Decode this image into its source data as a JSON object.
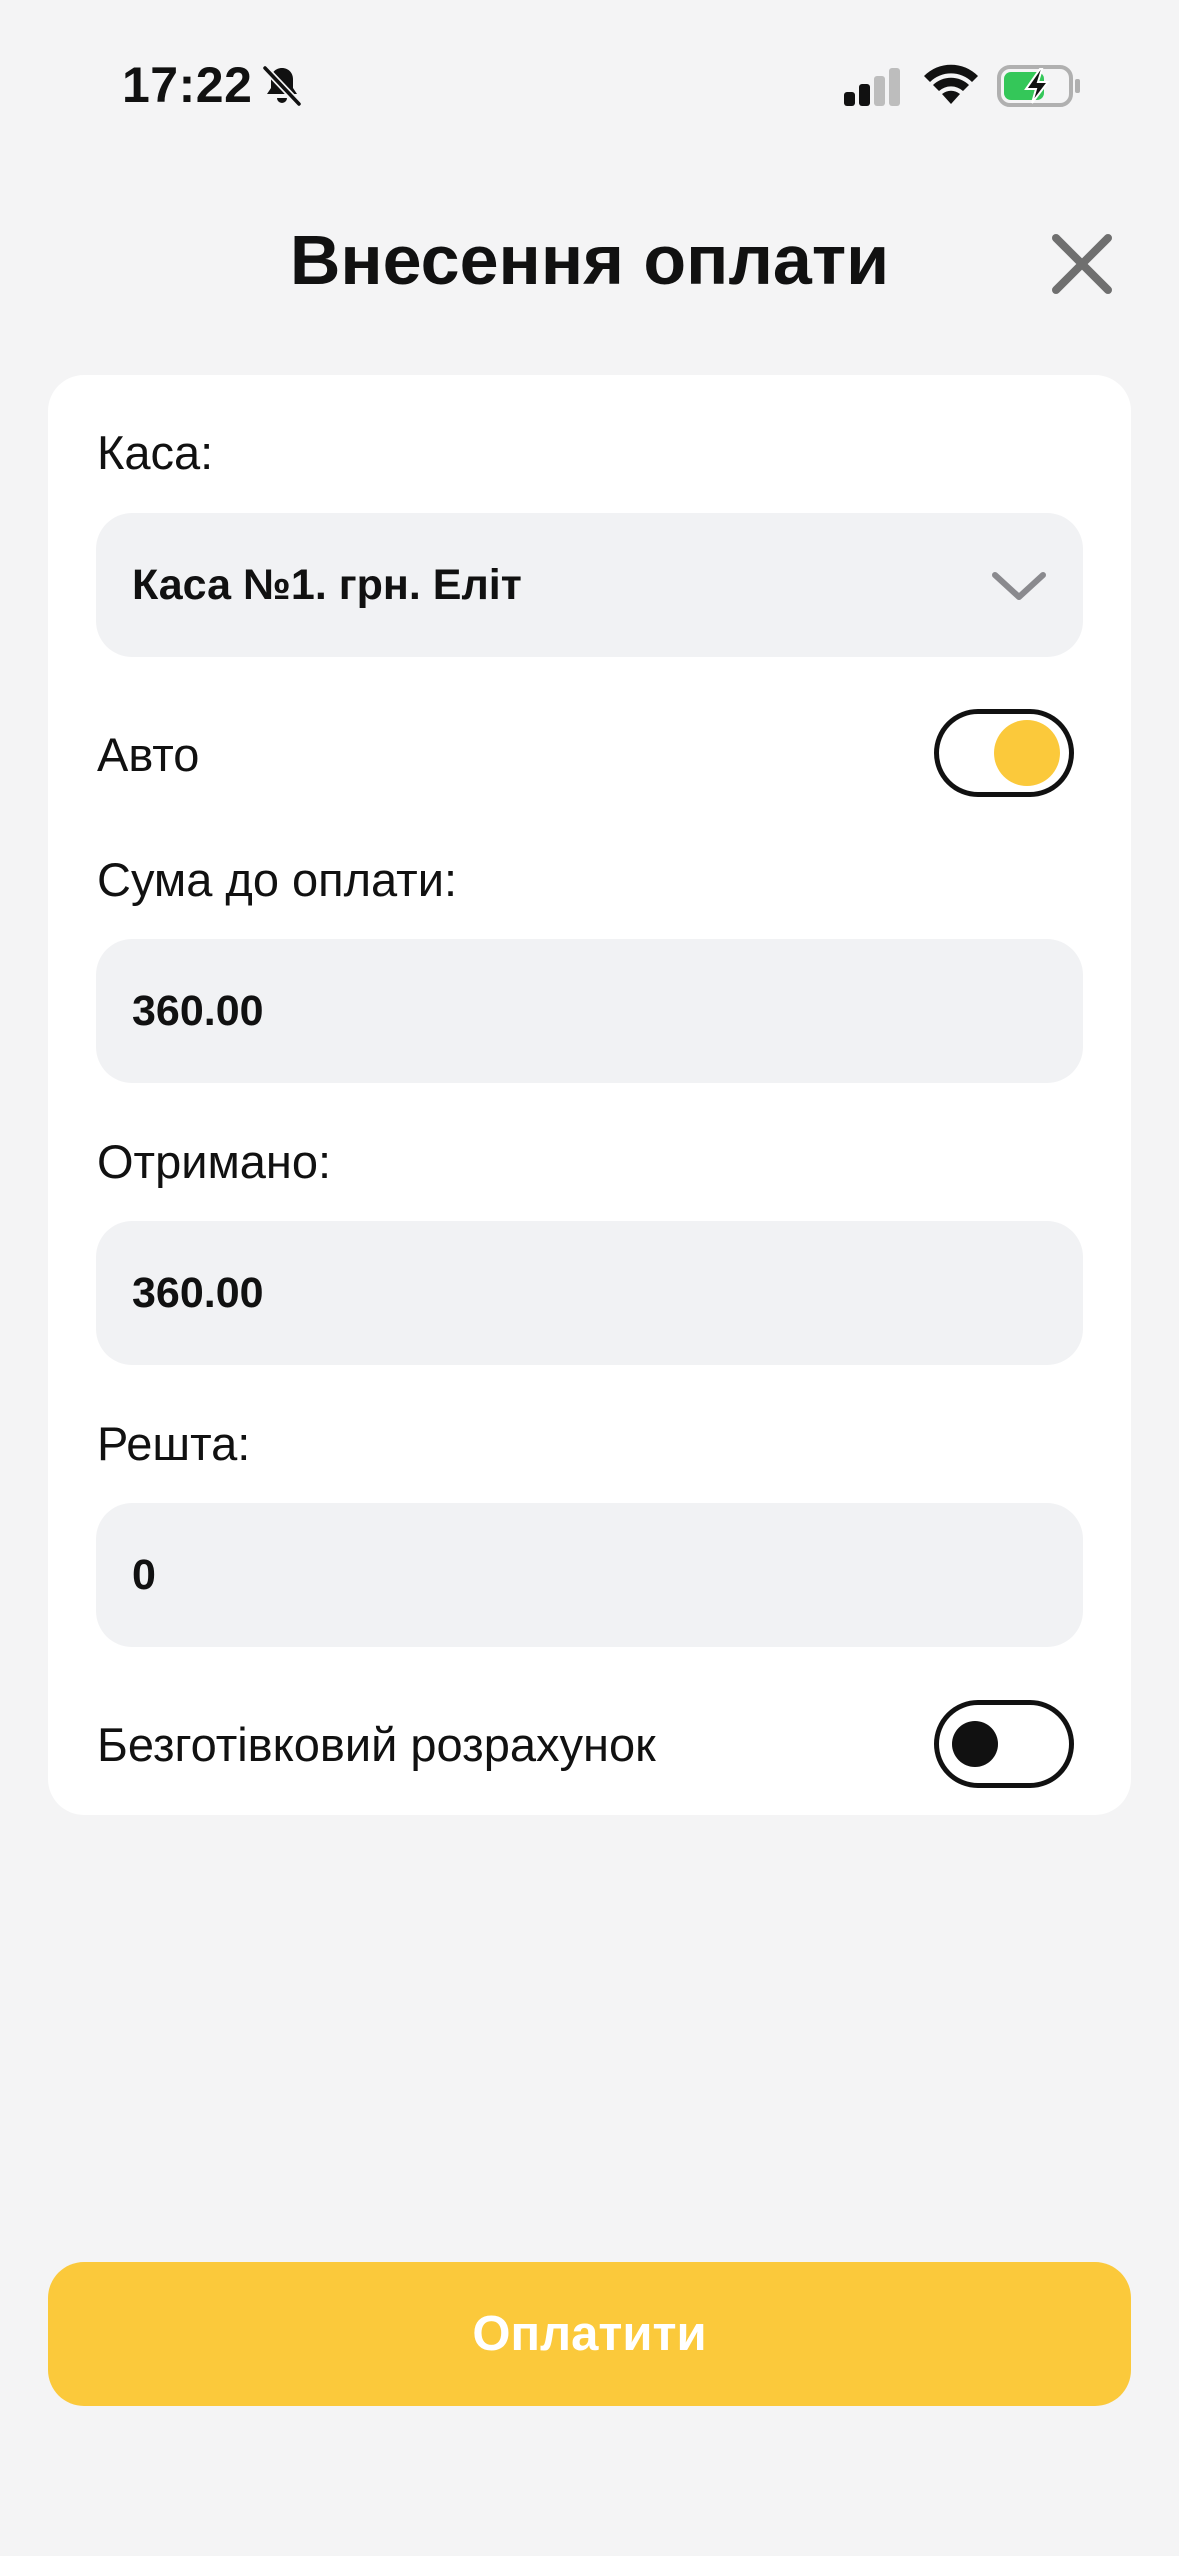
{
  "status_bar": {
    "time": "17:22",
    "bell_icon": "bell-slash-icon",
    "signal_icon": "cellular-signal-icon",
    "wifi_icon": "wifi-icon",
    "battery_icon": "battery-charging-icon",
    "battery_color": "#34c759"
  },
  "header": {
    "title": "Внесення оплати",
    "close_icon": "close-icon"
  },
  "form": {
    "cash_register": {
      "label": "Каса:",
      "value": "Каса №1. грн. Еліт",
      "icon": "chevron-down-icon"
    },
    "auto": {
      "label": "Авто",
      "enabled": true
    },
    "amount_due": {
      "label": "Сума до оплати:",
      "value": "360.00"
    },
    "received": {
      "label": "Отримано:",
      "value": "360.00"
    },
    "change": {
      "label": "Решта:",
      "value": "0"
    },
    "cashless": {
      "label": "Безготівковий розрахунок",
      "enabled": false
    }
  },
  "pay_button": {
    "label": "Оплатити"
  },
  "colors": {
    "accent": "#fbc93b",
    "background": "#f4f4f5",
    "card": "#ffffff",
    "field": "#f1f2f4"
  }
}
